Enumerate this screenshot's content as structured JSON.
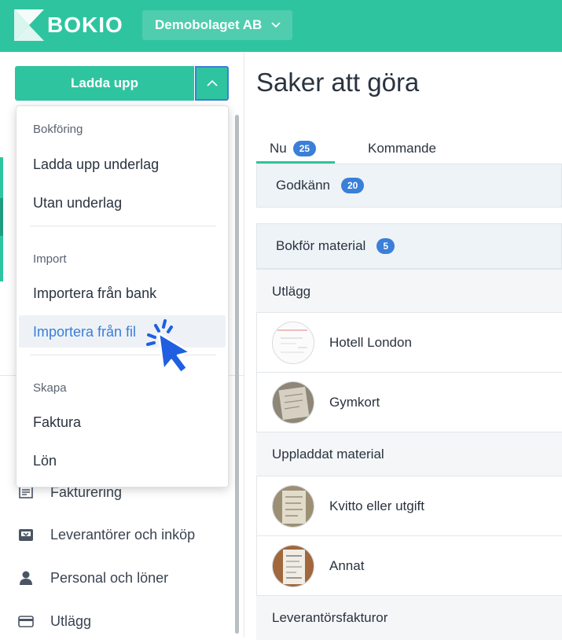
{
  "brand": {
    "name": "BOKIO",
    "accent": "#2fc4a0",
    "highlight": "#3a7fd8"
  },
  "company": {
    "name": "Demobolaget AB",
    "icon": "chevron-down-icon"
  },
  "sidebar": {
    "upload_button": "Ladda upp",
    "upload_toggle_icon": "chevron-up-icon",
    "nav_items": [
      {
        "label": "Fakturering",
        "icon": "invoice-icon"
      },
      {
        "label": "Leverantörer och inköp",
        "icon": "inbox-download-icon"
      },
      {
        "label": "Personal och löner",
        "icon": "person-icon"
      },
      {
        "label": "Utlägg",
        "icon": "card-icon"
      }
    ]
  },
  "menu": {
    "sections": [
      {
        "title": "Bokföring",
        "items": [
          "Ladda upp underlag",
          "Utan underlag"
        ]
      },
      {
        "title": "Import",
        "items": [
          "Importera från bank",
          "Importera från fil"
        ]
      },
      {
        "title": "Skapa",
        "items": [
          "Faktura",
          "Lön"
        ]
      }
    ],
    "active_item": "Importera från fil"
  },
  "main": {
    "title": "Saker att göra",
    "tabs": [
      {
        "label": "Nu",
        "count": "25"
      },
      {
        "label": "Kommande"
      }
    ],
    "approve": {
      "label": "Godkänn",
      "count": "20"
    },
    "book": {
      "label": "Bokför material",
      "count": "5"
    },
    "groups": [
      {
        "title": "Utlägg",
        "items": [
          "Hotell London",
          "Gymkort"
        ]
      },
      {
        "title": "Uppladdat material",
        "items": [
          "Kvitto eller utgift",
          "Annat"
        ]
      },
      {
        "title": "Leverantörsfakturor",
        "items": []
      }
    ]
  }
}
